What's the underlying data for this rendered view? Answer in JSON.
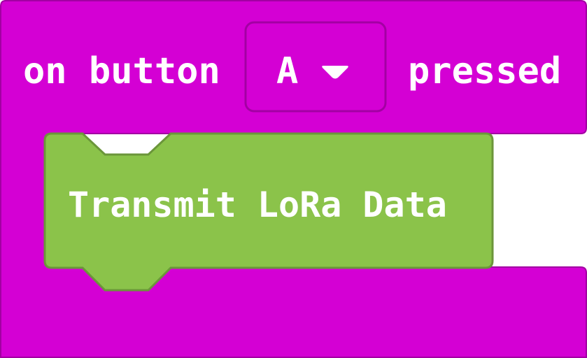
{
  "event_block": {
    "label_prefix": "on button",
    "selected_button": "A",
    "label_suffix": "pressed",
    "color": "#d400d4",
    "border_color": "#a300a3",
    "dropdown_icon": "triangle-down-icon"
  },
  "statement_block": {
    "label": "Transmit LoRa Data",
    "color": "#8bc34a",
    "border_color": "#6b963a"
  }
}
